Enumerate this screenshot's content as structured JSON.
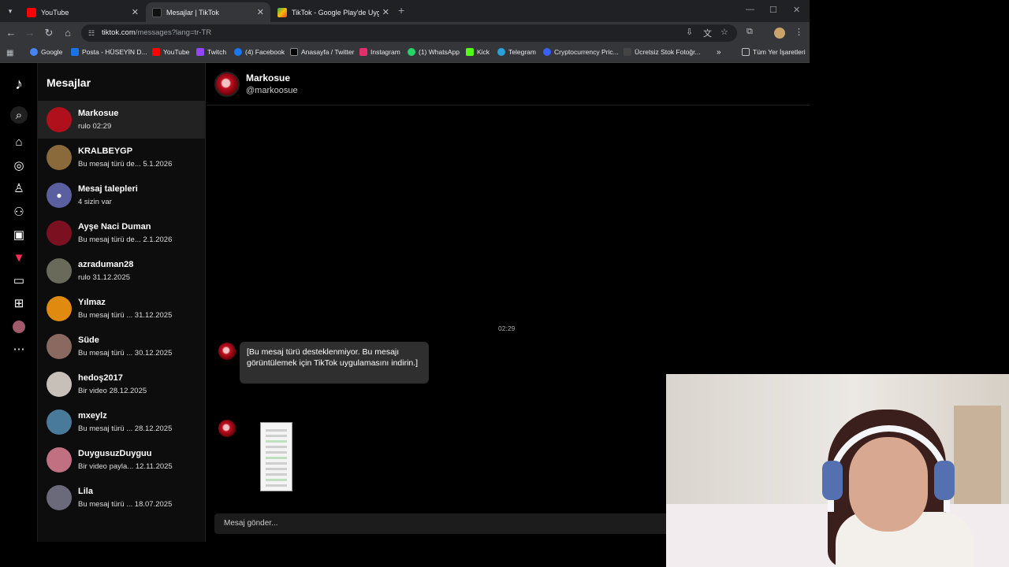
{
  "browser": {
    "tabs": [
      {
        "title": "YouTube",
        "active": false,
        "favicon_color": "#ff0000"
      },
      {
        "title": "Mesajlar | TikTok",
        "active": true,
        "favicon_color": "#000000"
      },
      {
        "title": "TikTok - Google Play'de Uygula",
        "active": false,
        "favicon_color": "#34a853"
      }
    ],
    "url_host": "tiktok.com",
    "url_path": "/messages?lang=tr-TR",
    "bookmarks": [
      {
        "label": "Google",
        "color": "#4285f4"
      },
      {
        "label": "Posta - HÜSEYİN D...",
        "color": "#1a73e8"
      },
      {
        "label": "YouTube",
        "color": "#ff0000"
      },
      {
        "label": "Twitch",
        "color": "#9146ff"
      },
      {
        "label": "(4) Facebook",
        "color": "#1877f2"
      },
      {
        "label": "Anasayfa / Twitter",
        "color": "#e8eaed"
      },
      {
        "label": "Instagram",
        "color": "#e1306c"
      },
      {
        "label": "(1) WhatsApp",
        "color": "#25d366"
      },
      {
        "label": "Kick",
        "color": "#53fc18"
      },
      {
        "label": "Telegram",
        "color": "#2aa1da"
      },
      {
        "label": "Cryptocurrency Pric...",
        "color": "#3861fb"
      },
      {
        "label": "Ücretsiz Stok Fotoğr...",
        "color": "#e8eaed"
      }
    ],
    "all_bookmarks": "Tüm Yer İşaretleri"
  },
  "sidebar_title": "Mesajlar",
  "conversations": [
    {
      "name": "Markosue",
      "preview": "rulo 02:29",
      "active": true,
      "avatar_color": "#b0101c"
    },
    {
      "name": "KRALBEYGP",
      "preview": "Bu mesaj türü de...  5.1.2026",
      "active": false,
      "avatar_color": "#8a6a3a"
    },
    {
      "name": "Mesaj talepleri",
      "preview": "4 sizin var",
      "active": false,
      "avatar_color": "#5a5fa0"
    },
    {
      "name": "Ayşe Naci Duman",
      "preview": "Bu mesaj türü de...  2.1.2026",
      "active": false,
      "avatar_color": "#7a1020"
    },
    {
      "name": "azraduman28",
      "preview": "rulo 31.12.2025",
      "active": false,
      "avatar_color": "#6a6a5a"
    },
    {
      "name": "Yılmaz",
      "preview": "Bu mesaj türü ...   31.12.2025",
      "active": false,
      "avatar_color": "#e08a10"
    },
    {
      "name": "Süde",
      "preview": "Bu mesaj türü ...   30.12.2025",
      "active": false,
      "avatar_color": "#8a6a60"
    },
    {
      "name": "hedoş2017",
      "preview": "Bir video 28.12.2025",
      "active": false,
      "avatar_color": "#c7c0b8"
    },
    {
      "name": "mxeylz",
      "preview": "Bu mesaj türü ...   28.12.2025",
      "active": false,
      "avatar_color": "#4a7a9a"
    },
    {
      "name": "DuygusuzDuyguu",
      "preview": "Bir video payla...   12.11.2025",
      "active": false,
      "avatar_color": "#c07080"
    },
    {
      "name": "Lila",
      "preview": "Bu mesaj türü ...   18.07.2025",
      "active": false,
      "avatar_color": "#6a6a7a"
    }
  ],
  "chat": {
    "name": "Markosue",
    "handle": "@markoosue",
    "timestamp": "02:29",
    "message": "[Bu mesaj türü desteklenmiyor. Bu mesajı görüntülemek için TikTok uygulamasını indirin.]",
    "composer_placeholder": "Mesaj gönder..."
  },
  "icons": {
    "rail": [
      "tiktok-logo-icon",
      "search-icon",
      "home-icon",
      "explore-icon",
      "following-icon",
      "friends-icon",
      "live-icon",
      "activity-icon",
      "messages-icon",
      "upload-icon",
      "profile-icon",
      "more-icon"
    ]
  }
}
